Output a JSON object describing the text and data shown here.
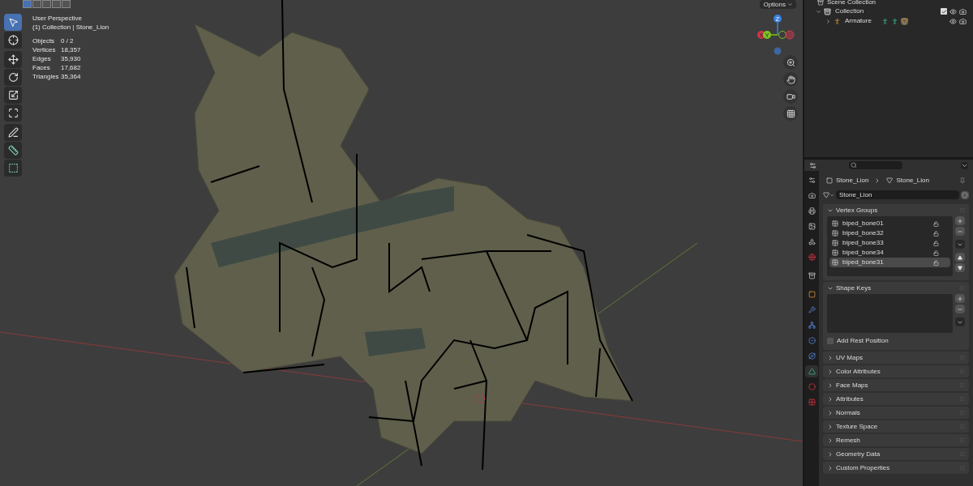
{
  "viewport": {
    "select_modes": [
      {
        "selected": true
      },
      {
        "selected": false
      },
      {
        "selected": false
      },
      {
        "selected": false
      },
      {
        "selected": false
      }
    ],
    "title": "User Perspective",
    "subtitle": "(1) Collection | Stone_Lion",
    "stats": [
      {
        "label": "Objects",
        "value": "0 / 2"
      },
      {
        "label": "Vertices",
        "value": "18,357"
      },
      {
        "label": "Edges",
        "value": "35,930"
      },
      {
        "label": "Faces",
        "value": "17,682"
      },
      {
        "label": "Triangles",
        "value": "35,364"
      }
    ],
    "tools": [
      {
        "kind": "select",
        "selected": true
      },
      {
        "kind": "cursor",
        "selected": false
      },
      {
        "kind": "move",
        "selected": false
      },
      {
        "kind": "rotate",
        "selected": false
      },
      {
        "kind": "scale",
        "selected": false
      },
      {
        "kind": "transform",
        "selected": false
      },
      {
        "kind": "annotate",
        "selected": false
      },
      {
        "kind": "measure",
        "selected": false
      },
      {
        "kind": "add_cube",
        "selected": false
      }
    ],
    "options_button": "Options",
    "gizmo_labels": [
      "Z",
      "X",
      "Y"
    ],
    "nav_buttons": [
      {
        "kind": "zoom"
      },
      {
        "kind": "pan"
      },
      {
        "kind": "camera"
      },
      {
        "kind": "ortho"
      }
    ]
  },
  "outliner": {
    "root": "Scene Collection",
    "tree": [
      {
        "label": "Collection",
        "kind": "collection",
        "expanded": true,
        "checked": true,
        "children": [
          {
            "label": "Armature",
            "kind": "armature",
            "expanded": false
          }
        ]
      }
    ]
  },
  "properties": {
    "breadcrumb": [
      "Stone_Lion",
      "Stone_Lion"
    ],
    "data_name": "Stone_Lion",
    "tabs": [
      {
        "kind": "tool",
        "selected": false
      },
      {
        "kind": "render",
        "selected": false
      },
      {
        "kind": "output",
        "selected": false
      },
      {
        "kind": "view_layer",
        "selected": false
      },
      {
        "kind": "scene",
        "selected": false
      },
      {
        "kind": "world",
        "selected": false
      },
      {
        "kind": "collection",
        "selected": false
      },
      {
        "kind": "object",
        "selected": false
      },
      {
        "kind": "modifiers",
        "selected": false
      },
      {
        "kind": "particles",
        "selected": false
      },
      {
        "kind": "physics",
        "selected": false
      },
      {
        "kind": "constraints",
        "selected": false
      },
      {
        "kind": "data",
        "selected": true
      },
      {
        "kind": "material",
        "selected": false
      },
      {
        "kind": "texture",
        "selected": false
      }
    ],
    "panels": [
      {
        "title": "Vertex Groups",
        "expanded": true,
        "kind": "list",
        "items": [
          {
            "label": "biped_bone01",
            "selected": false
          },
          {
            "label": "biped_bone32",
            "selected": false
          },
          {
            "label": "biped_bone33",
            "selected": false
          },
          {
            "label": "biped_bone34",
            "selected": false
          },
          {
            "label": "biped_bone31",
            "selected": true
          }
        ]
      },
      {
        "title": "Shape Keys",
        "expanded": true,
        "kind": "shape_keys",
        "option": {
          "label": "Add Rest Position",
          "checked": false
        }
      },
      {
        "title": "UV Maps",
        "expanded": false
      },
      {
        "title": "Color Attributes",
        "expanded": false
      },
      {
        "title": "Face Maps",
        "expanded": false
      },
      {
        "title": "Attributes",
        "expanded": false
      },
      {
        "title": "Normals",
        "expanded": false
      },
      {
        "title": "Texture Space",
        "expanded": false
      },
      {
        "title": "Remesh",
        "expanded": false
      },
      {
        "title": "Geometry Data",
        "expanded": false
      },
      {
        "title": "Custom Properties",
        "expanded": false
      }
    ]
  }
}
